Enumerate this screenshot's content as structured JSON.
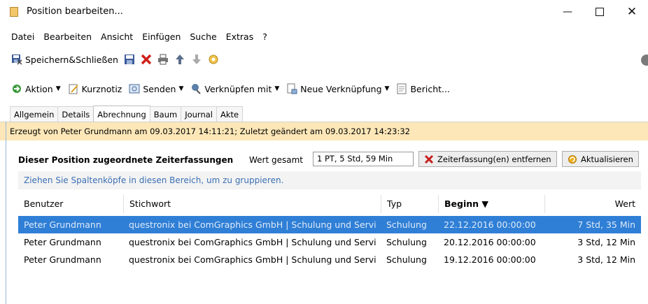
{
  "window": {
    "title": "Position bearbeiten..."
  },
  "menu": [
    "Datei",
    "Bearbeiten",
    "Ansicht",
    "Einfügen",
    "Suche",
    "Extras",
    "?"
  ],
  "toolbar1": {
    "save_close_label": "Speichern&Schließen"
  },
  "toolbar2": {
    "aktion": "Aktion",
    "kurznotiz": "Kurznotiz",
    "senden": "Senden",
    "verknuepfen": "Verknüpfen mit",
    "neue_verknuepfung": "Neue Verknüpfung",
    "bericht": "Bericht..."
  },
  "tabs": [
    "Allgemein",
    "Details",
    "Abrechnung",
    "Baum",
    "Journal",
    "Akte"
  ],
  "active_tab": "Abrechnung",
  "info": "Erzeugt von Peter Grundmann am 09.03.2017 14:11:21; Zuletzt geändert am 09.03.2017 14:23:32",
  "section": {
    "title": "Dieser Position zugeordnete Zeiterfassungen",
    "wert_label": "Wert gesamt",
    "wert_value": "1 PT, 5 Std, 59 Min",
    "remove_label": "Zeiterfassung(en) entfernen",
    "refresh_label": "Aktualisieren"
  },
  "grid": {
    "group_hint": "Ziehen Sie Spaltenköpfe in diesen Bereich, um zu gruppieren.",
    "columns": [
      "Benutzer",
      "Stichwort",
      "Typ",
      "Beginn ▼",
      "Wert"
    ],
    "rows": [
      [
        "Peter Grundmann",
        "questronix bei ComGraphics GmbH | Schulung und Servi",
        "Schulung",
        "22.12.2016 00:00:00",
        "7 Std, 35 Min"
      ],
      [
        "Peter Grundmann",
        "questronix bei ComGraphics GmbH | Schulung und Servi",
        "Schulung",
        "20.12.2016 00:00:00",
        "3 Std, 12 Min"
      ],
      [
        "Peter Grundmann",
        "questronix bei ComGraphics GmbH | Schulung und Servi",
        "Schulung",
        "19.12.2016 00:00:00",
        "3 Std, 12 Min"
      ]
    ]
  },
  "colors": {
    "selection": "#2f7fd6",
    "infobar": "#fde7b8",
    "hint_text": "#3b6fb5"
  }
}
